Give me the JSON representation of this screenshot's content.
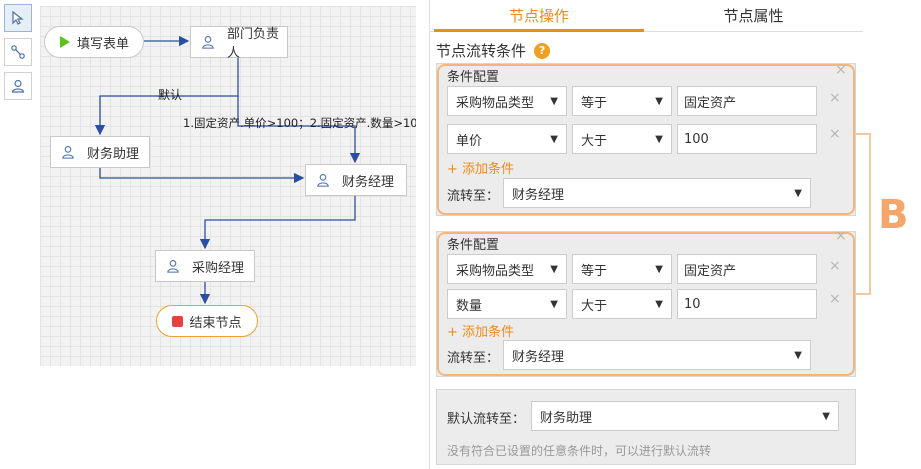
{
  "toolbar": {
    "tools": [
      "pointer-icon",
      "connector-icon",
      "user-node-icon"
    ]
  },
  "flow": {
    "start_label": "填写表单",
    "dept_head_label": "部门负责人",
    "finance_assistant_label": "财务助理",
    "finance_manager_label": "财务经理",
    "purchase_manager_label": "采购经理",
    "end_label": "结束节点",
    "default_edge_label": "默认",
    "condition_edge_label": "1.固定资产.单价>100；2.固定资产.数量>10"
  },
  "panel": {
    "tab_node_ops": "节点操作",
    "tab_node_props": "节点属性",
    "section_title": "节点流转条件",
    "help_icon": "?",
    "conditions": [
      {
        "title": "条件配置",
        "rows": [
          {
            "field": "采购物品类型",
            "op": "等于",
            "value": "固定资产"
          },
          {
            "field": "单价",
            "op": "大于",
            "value": "100"
          }
        ],
        "add_label": "+ 添加条件",
        "flow_to_label": "流转至：",
        "flow_to_value": "财务经理"
      },
      {
        "title": "条件配置",
        "rows": [
          {
            "field": "采购物品类型",
            "op": "等于",
            "value": "固定资产"
          },
          {
            "field": "数量",
            "op": "大于",
            "value": "10"
          }
        ],
        "add_label": "+ 添加条件",
        "flow_to_label": "流转至：",
        "flow_to_value": "财务经理"
      }
    ],
    "default_flow_label": "默认流转至：",
    "default_flow_value": "财务助理",
    "default_hint": "没有符合已设置的任意条件时，可以进行默认流转",
    "annotation_letter": "B"
  },
  "colors": {
    "accent": "#f08a1c",
    "highlight": "#f5b57a",
    "line": "#2b4fa0",
    "start_icon": "#5cc21c",
    "end_icon": "#e84040"
  }
}
